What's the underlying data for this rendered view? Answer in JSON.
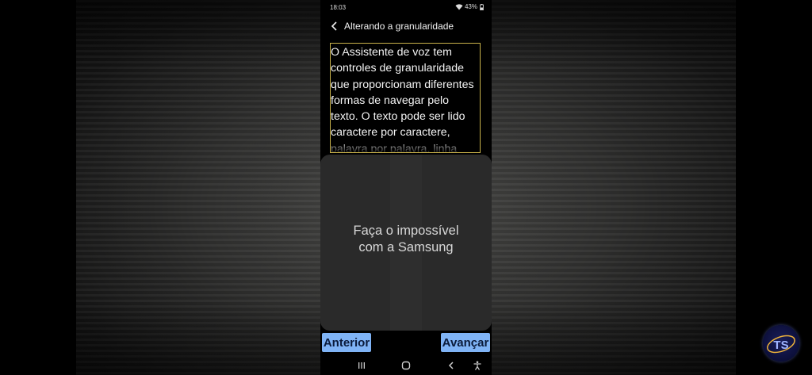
{
  "status_bar": {
    "time": "18:03",
    "battery_percent": "43%",
    "icons": [
      "wifi-icon",
      "battery-icon"
    ]
  },
  "app_bar": {
    "back_icon": "chevron-left-icon",
    "title": "Alterando a granularidade"
  },
  "content": {
    "body_text": "O Assistente de voz tem\ncontroles de granularidade\nque proporcionam diferentes\nformas de navegar pelo\ntexto. O texto pode ser lido\ncaractere por caractere,\npalavra por palavra, linha",
    "frame_color": "#c9b24a"
  },
  "overlay": {
    "text": "Faça o impossível\ncom a Samsung"
  },
  "navigation": {
    "prev_label": "Anterior",
    "next_label": "Avançar",
    "button_color": "#7fb3f5"
  },
  "system_nav": {
    "icons": [
      "recent-apps-icon",
      "home-icon",
      "back-icon",
      "accessibility-icon"
    ]
  },
  "logo": {
    "text": "TS"
  }
}
